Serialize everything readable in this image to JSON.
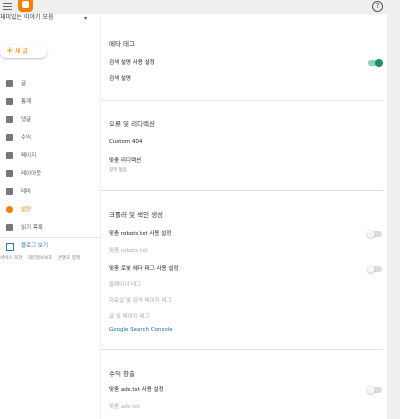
{
  "app": {
    "help_glyph": "?"
  },
  "sidebar": {
    "blog_name": "재미있는 이야기 모음",
    "new_post": "새 글",
    "items": [
      {
        "label": "글",
        "icon": "posts-icon"
      },
      {
        "label": "통계",
        "icon": "stats-icon"
      },
      {
        "label": "댓글",
        "icon": "comments-icon"
      },
      {
        "label": "수익",
        "icon": "earnings-icon"
      },
      {
        "label": "페이지",
        "icon": "pages-icon"
      },
      {
        "label": "레이아웃",
        "icon": "layout-icon"
      },
      {
        "label": "테마",
        "icon": "theme-icon"
      },
      {
        "label": "설정",
        "icon": "settings-icon",
        "active": true
      },
      {
        "label": "읽기 목록",
        "icon": "reading-list-icon"
      }
    ],
    "view_blog": "블로그 보기",
    "footer": [
      "서비스 약관",
      "개인정보보호",
      "콘텐츠 정책"
    ]
  },
  "settings": {
    "meta": {
      "title": "메타 태그",
      "enable_search_desc": "검색 설명 사용 설정",
      "search_desc": "검색 설명",
      "enable_search_desc_on": true
    },
    "errors": {
      "title": "오류 및 리디렉션",
      "custom404": "Custom 404",
      "custom_redirects": "맞춤 리디렉션",
      "custom_redirects_value": "항목 없음"
    },
    "crawlers": {
      "title": "크롤러 및 색인 생성",
      "enable_robots": "맞춤 robots.txt 사용 설정",
      "enable_robots_on": false,
      "robots_txt": "맞춤 robots.txt",
      "enable_robot_tags": "맞춤 로봇 헤더 태그 사용 설정",
      "enable_robot_tags_on": false,
      "home_tags": "홈페이지 태그",
      "archive_tags": "자료실 및 검색 페이지 태그",
      "post_tags": "글 및 페이지 태그",
      "search_console": "Google Search Console"
    },
    "monetization": {
      "title": "수익 창출",
      "enable_ads_txt": "맞춤 ads.txt 사용 설정",
      "enable_ads_txt_on": false,
      "ads_txt": "맞춤 ads.txt"
    }
  },
  "colors": {
    "accent": "#f57d00",
    "toggle_on": "#1e8e6e",
    "link": "#1a73a8"
  }
}
